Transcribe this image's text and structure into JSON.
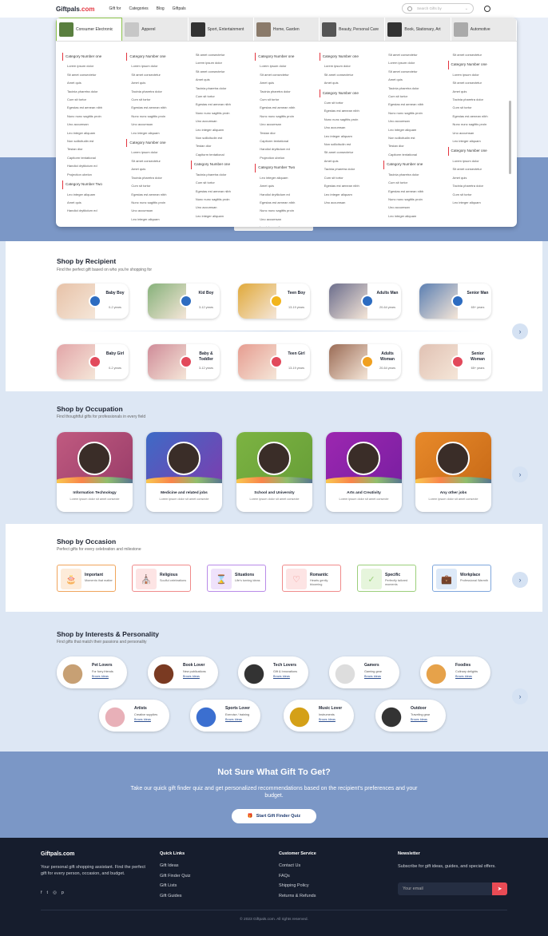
{
  "header": {
    "logo_main": "Giftpals",
    "logo_tld": ".com",
    "nav": [
      "Gift for",
      "Categories",
      "Blog",
      "Giftpals"
    ],
    "search_placeholder": "Search Gifts by"
  },
  "mega": {
    "tabs": [
      "Consumer Electronic",
      "Apperel",
      "Sport, Entertainment",
      "Home, Garden",
      "Beauty, Personal Care",
      "Book, Stationary, Art",
      "Automotive"
    ],
    "tab_colors": [
      "#5a7f3f",
      "#c7c7c7",
      "#333",
      "#8a7a6a",
      "#555",
      "#333",
      "#aaa"
    ],
    "columns": [
      [
        {
          "h": "Category Number one"
        },
        "Lorem ipsum dolor",
        "Sit amet consectetur",
        "Amet quis",
        "Tacinia pharetra dolor",
        "Cum sit tortor",
        "Egestas est aenean nibh",
        "Nunc nunc sagittis proin",
        "Uno accumsan",
        "Leo integer aliquam",
        "Non sollicitudin est",
        "Testan dior",
        "Capitorm tentational",
        "Handiol drytikdum ed",
        "Projection ubelon",
        {
          "h": "Category Number Two"
        },
        "Leo integer aliquam",
        "Amet quis",
        "Handiol drytikdum ed"
      ],
      [
        {
          "h": "Category Number one"
        },
        "Lorem ipsum dolor",
        "Sit amet consectetur",
        "Amet quis",
        "Tacinia pharetra dolor",
        "Cum sit tortor",
        "Egestas est aenean nibh",
        "Nunc nunc sagittis proin",
        "Uno accumsan",
        "Leo integer aliquam",
        {
          "h": "Category Number one"
        },
        "Lorem ipsum dolor",
        "Sit amet consectetur",
        "Amet quis",
        "Tacinia pharetra dolor",
        "Cum sit tortor",
        "Egestas est aenean nibh",
        "Nunc nunc sagittis proin",
        "Uno accumsan",
        "Leo integer aliquam"
      ],
      [
        "Sit amet consectetur",
        "Lorem ipsum dolor",
        "Sit amet consectetur",
        "Amet quis",
        "Tacinia pharetra dolor",
        "Cum sit tortor",
        "Egestas est aenean nibh",
        "Nunc nunc sagittis proin",
        "Uno accumsan",
        "Leo integer aliquam",
        "Non sollicitudin est",
        "Testan dior",
        "Capitorm tentational",
        {
          "h": "Category Number one"
        },
        "Tacinia pharetra dolor",
        "Cum sit tortor",
        "Egestas est aenean nibh",
        "Nunc nunc sagittis proin",
        "Uno accumsan",
        "Leo integer aliquam"
      ],
      [
        {
          "h": "Category Number one"
        },
        "Lorem ipsum dolor",
        "Sit amet consectetur",
        "Amet quis",
        "Tacinia pharetra dolor",
        "Cum sit tortor",
        "Egestas est aenean nibh",
        "Nunc nunc sagittis proin",
        "Uno accumsan",
        "Testan dior",
        "Capitorm tentational",
        "Handiol drytikdum ed",
        "Projection ubelon",
        {
          "h": "Category Number Two"
        },
        "Leo integer aliquam",
        "Amet quis",
        "Handiol drytikdum ed",
        "Egestas est aenean nibh",
        "Nunc nunc sagittis proin",
        "Uno accumsan",
        "Leo integer aliquam",
        "Non sollicitudin est"
      ],
      [
        {
          "h": "Category Number one"
        },
        "Lorem ipsum dolor",
        "Sit amet consectetur",
        "Amet quis",
        {
          "h": "Category Number one"
        },
        "Cum sit tortor",
        "Egestas est aenean nibh",
        "Nunc nunc sagittis proin",
        "Uno accumsan",
        "Leo integer aliquam",
        "Non sollicitudin est",
        "Sit amet consectetur",
        "Amet quis",
        "Tacinia pharetra dolor",
        "Cum sit tortor",
        "Egestas est aenean nibh",
        "Leo integer aliquam",
        "Uno accumsan"
      ],
      [
        "Sit amet consectetur",
        "Lorem ipsum dolor",
        "Sit amet consectetur",
        "Amet quis",
        "Tacinia pharetra dolor",
        "Cum sit tortor",
        "Egestas est aenean nibh",
        "Nunc nunc sagittis proin",
        "Uno accumsan",
        "Leo integer aliquam",
        "Non sollicitudin est",
        "Testan dior",
        "Capitorm tentational",
        {
          "h": "Category Number one"
        },
        "Tacinia pharetra dolor",
        "Cum sit tortor",
        "Egestas est aenean nibh",
        "Nunc nunc sagittis proin",
        "Uno accumsan",
        "Leo integer aliquam"
      ],
      [
        "Sit amet consectetur",
        {
          "h": "Category Number one"
        },
        "Lorem ipsum dolor",
        "Sit amet consectetur",
        "Amet quis",
        "Tacinia pharetra dolor",
        "Cum sit tortor",
        "Egestas est aenean nibh",
        "Nunc nunc sagittis proin",
        "Uno accumsan",
        "Leo integer aliquam",
        {
          "h": "Category Number one"
        },
        "Lorem ipsum dolor",
        "Sit amet consectetur",
        "Amet quis",
        "Tacinia pharetra dolor",
        "Cum sit tortor",
        "Leo integer aliquam"
      ]
    ]
  },
  "recipient": {
    "title": "Shop by Recipient",
    "subtitle": "Find the perfect gift based on who you're shopping for",
    "row1": [
      {
        "name": "Baby Boy",
        "age": "0-2 years",
        "skin": "#e7c2a8",
        "badge": "#2d6cc1"
      },
      {
        "name": "Kid Boy",
        "age": "3-12 years",
        "skin": "#86b17a",
        "badge": "#2d6cc1"
      },
      {
        "name": "Teen Boy",
        "age": "13-19 years",
        "skin": "#e0a93a",
        "badge": "#f2b51c"
      },
      {
        "name": "Adults Man",
        "age": "20-64 years",
        "skin": "#6b6d8c",
        "badge": "#2d6cc1"
      },
      {
        "name": "Senior Man",
        "age": "65+ years",
        "skin": "#5b7fb2",
        "badge": "#2d6cc1"
      }
    ],
    "row2": [
      {
        "name": "Baby Girl",
        "age": "0-2 years",
        "skin": "#e2a5a8",
        "badge": "#e2495b"
      },
      {
        "name": "Baby & Toddler",
        "age": "3-12 years",
        "skin": "#cf8b98",
        "badge": "#e2495b"
      },
      {
        "name": "Teen Girl",
        "age": "13-19 years",
        "skin": "#e69c90",
        "badge": "#e2495b"
      },
      {
        "name": "Adults Woman",
        "age": "20-64 years",
        "skin": "#9a6b55",
        "badge": "#f0a020"
      },
      {
        "name": "Senior Woman",
        "age": "65+ years",
        "skin": "#e0c1b3",
        "badge": "#e2495b"
      }
    ]
  },
  "occupation": {
    "title": "Shop by Occupation",
    "subtitle": "Find thoughtful gifts for professionals in every field",
    "items": [
      {
        "name": "Information Technology",
        "desc": "Lorem ipsum dolor sit amet consecte",
        "c1": "#c05a80",
        "c2": "#9b3e6a",
        "icon": "monitor-icon"
      },
      {
        "name": "Medicine and related jobs",
        "desc": "Lorem ipsum dolor sit amet consecte",
        "c1": "#3d6bc6",
        "c2": "#7a3fb0",
        "icon": "stethoscope-icon"
      },
      {
        "name": "School and University",
        "desc": "Lorem ipsum dolor sit amet consecte",
        "c1": "#7cb342",
        "c2": "#689f38",
        "icon": "graduation-cap-icon"
      },
      {
        "name": "Arts and Creativity",
        "desc": "Lorem ipsum dolor sit amet consecte",
        "c1": "#9c27b0",
        "c2": "#7b1fa2",
        "icon": "palette-icon"
      },
      {
        "name": "Any other jobs",
        "desc": "Lorem ipsum dolor sit amet consecte",
        "c1": "#e88a2a",
        "c2": "#c96b18",
        "icon": "briefcase-icon"
      }
    ]
  },
  "occasion": {
    "title": "Shop by Occasion",
    "subtitle": "Perfect gifts for every celebration and milestone",
    "items": [
      {
        "name": "Important",
        "desc": "Moments that matter",
        "bg": "#fdebd9",
        "border": "#f0a45b",
        "icon": "cake-icon",
        "glyph": "🎂"
      },
      {
        "name": "Religious",
        "desc": "Soulful celebrations",
        "bg": "#fde4e4",
        "border": "#f08a8a",
        "icon": "church-icon",
        "glyph": "⛪"
      },
      {
        "name": "Situations",
        "desc": "Life's turning ideas",
        "bg": "#efe2fb",
        "border": "#b98ae8",
        "icon": "hourglass-icon",
        "glyph": "⌛"
      },
      {
        "name": "Romantic",
        "desc": "Hearts gently blooming",
        "bg": "#fde4e4",
        "border": "#f08a8a",
        "icon": "heart-icon",
        "glyph": "♡"
      },
      {
        "name": "Specific",
        "desc": "Perfectly tailored moments",
        "bg": "#e6f5dc",
        "border": "#9bcf7a",
        "icon": "badge-icon",
        "glyph": "✓"
      },
      {
        "name": "Workplace",
        "desc": "Professional Warmth",
        "bg": "#dde9f8",
        "border": "#7ea6dc",
        "icon": "briefcase-icon",
        "glyph": "💼"
      }
    ]
  },
  "interests": {
    "title": "Shop by Interests & Personality",
    "subtitle": "Find gifts that match their passions and personality",
    "row1": [
      {
        "name": "Pet Lovers",
        "desc": "For furry friends",
        "link": "Brows Ideas",
        "color": "#c7a074"
      },
      {
        "name": "Book Lover",
        "desc": "New publications",
        "link": "Brows Ideas",
        "color": "#7a3a22"
      },
      {
        "name": "Tech Lovers",
        "desc": "Gift & Innovations",
        "link": "Brows Ideas",
        "color": "#333"
      },
      {
        "name": "Gamers",
        "desc": "Gaming gear",
        "link": "Brows Ideas",
        "color": "#ddd"
      },
      {
        "name": "Foodies",
        "desc": "Culinary delights",
        "link": "Brows Ideas",
        "color": "#e6a24a"
      }
    ],
    "row2": [
      {
        "name": "Artists",
        "desc": "Creative supplies",
        "link": "Brows Ideas",
        "color": "#e8b0b8"
      },
      {
        "name": "Sports Lover",
        "desc": "Exercise / training",
        "link": "Brows Ideas",
        "color": "#3b6fd0"
      },
      {
        "name": "Music Lover",
        "desc": "Instruments",
        "link": "Brows Ideas",
        "color": "#d4a017"
      },
      {
        "name": "Outdoor",
        "desc": "Traveling gear",
        "link": "Brows Ideas",
        "color": "#333"
      }
    ]
  },
  "quiz": {
    "title": "Not Sure What Gift To Get?",
    "subtitle": "Take our quick gift finder quiz and get personalized recommendations based on the recipient's preferences and your budget.",
    "button": "Start Gift Finder Quiz"
  },
  "footer": {
    "logo": "Giftpals.com",
    "tagline": "Your personal gift shopping assistant. Find the perfect gift for every person, occasion, and budget.",
    "quick_title": "Quick Links",
    "quick": [
      "Gift Ideas",
      "Gift Finder Quiz",
      "Gift Lists",
      "Gift Guides"
    ],
    "service_title": "Customer Service",
    "service": [
      "Contact Us",
      "FAQs",
      "Shipping Policy",
      "Returns & Refunds"
    ],
    "news_title": "Newsletter",
    "news_text": "Subscribe for gift ideas, guides, and special offers.",
    "email_placeholder": "Your email",
    "copyright": "© 2023 Giftpals.com. All rights reserved.",
    "social": [
      "f",
      "t",
      "◎",
      "p"
    ]
  }
}
